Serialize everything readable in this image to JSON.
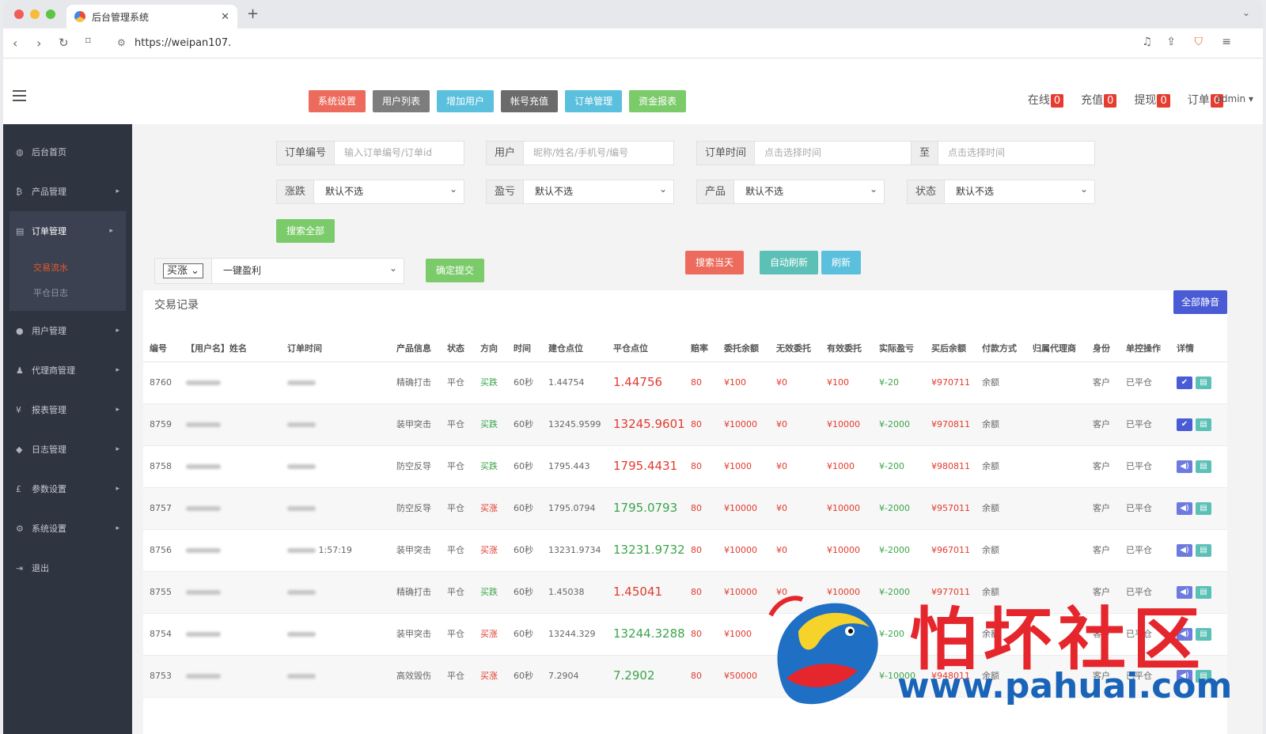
{
  "browser": {
    "tab_title": "后台管理系统",
    "url": "https://weipan107."
  },
  "header": {
    "buttons": [
      {
        "label": "系统设置",
        "color": "#ec6b5d"
      },
      {
        "label": "用户列表",
        "color": "#7d7d7d"
      },
      {
        "label": "增加用户",
        "color": "#5bc0de"
      },
      {
        "label": "帐号充值",
        "color": "#6b6b6b"
      },
      {
        "label": "订单管理",
        "color": "#5bc0de"
      },
      {
        "label": "资金报表",
        "color": "#7ccb6b"
      }
    ],
    "stats": [
      {
        "label": "在线",
        "count": "0"
      },
      {
        "label": "充值",
        "count": "0"
      },
      {
        "label": "提现",
        "count": "0"
      },
      {
        "label": "订单",
        "count": "0"
      }
    ],
    "user": "admin"
  },
  "sidebar": {
    "items": [
      {
        "label": "后台首页",
        "icon": "dashboard-icon"
      },
      {
        "label": "产品管理",
        "icon": "bitcoin-icon"
      },
      {
        "label": "订单管理",
        "icon": "order-icon"
      },
      {
        "label": "用户管理",
        "icon": "user-icon"
      },
      {
        "label": "代理商管理",
        "icon": "agent-icon"
      },
      {
        "label": "报表管理",
        "icon": "yen-icon"
      },
      {
        "label": "日志管理",
        "icon": "tag-icon"
      },
      {
        "label": "参数设置",
        "icon": "pound-icon"
      },
      {
        "label": "系统设置",
        "icon": "gears-icon"
      },
      {
        "label": "退出",
        "icon": "logout-icon"
      }
    ],
    "sub_items": [
      "交易流水",
      "平仓日志"
    ]
  },
  "filters": {
    "order_no_label": "订单编号",
    "order_no_placeholder": "输入订单编号/订单id",
    "user_label": "用户",
    "user_placeholder": "昵称/姓名/手机号/编号",
    "time_label": "订单时间",
    "time_start_placeholder": "点击选择时间",
    "to_label": "至",
    "time_end_placeholder": "点击选择时间",
    "rise_label": "涨跌",
    "rise_value": "默认不选",
    "pl_label": "盈亏",
    "pl_value": "默认不选",
    "product_label": "产品",
    "product_value": "默认不选",
    "status_label": "状态",
    "status_value": "默认不选",
    "search_all": "搜索全部"
  },
  "actions": {
    "direction_value": "买涨",
    "mode_value": "一键盈利",
    "confirm": "确定提交",
    "search_today": "搜索当天",
    "auto_refresh": "自动刷新",
    "refresh": "刷新"
  },
  "records": {
    "title": "交易记录",
    "mute_all": "全部静音",
    "columns": [
      "编号",
      "【用户名】姓名",
      "订单时间",
      "产品信息",
      "状态",
      "方向",
      "时间",
      "建仓点位",
      "平仓点位",
      "赔率",
      "委托余额",
      "无效委托",
      "有效委托",
      "实际盈亏",
      "买后余额",
      "付款方式",
      "归属代理商",
      "身份",
      "单控操作",
      "详情"
    ],
    "rows": [
      {
        "id": "8760",
        "time_text": "",
        "product": "精确打击",
        "status": "平仓",
        "dir": "买跌",
        "dir_color": "red",
        "dur": "60秒",
        "open": "1.44754",
        "close": "1.44756",
        "close_color": "red",
        "odds": "80",
        "entrust": "¥100",
        "invalid": "¥0",
        "valid": "¥100",
        "pl": "¥-20",
        "balance": "¥970711",
        "pay": "余额",
        "role": "客户",
        "ctrl": "已平仓",
        "icon": "check"
      },
      {
        "id": "8759",
        "time_text": "",
        "product": "装甲突击",
        "status": "平仓",
        "dir": "买跌",
        "dir_color": "red",
        "dur": "60秒",
        "open": "13245.9599",
        "close": "13245.9601",
        "close_color": "red",
        "odds": "80",
        "entrust": "¥10000",
        "invalid": "¥0",
        "valid": "¥10000",
        "pl": "¥-2000",
        "balance": "¥970811",
        "pay": "余额",
        "role": "客户",
        "ctrl": "已平仓",
        "icon": "check"
      },
      {
        "id": "8758",
        "time_text": "",
        "product": "防空反导",
        "status": "平仓",
        "dir": "买跌",
        "dir_color": "red",
        "dur": "60秒",
        "open": "1795.443",
        "close": "1795.4431",
        "close_color": "red",
        "odds": "80",
        "entrust": "¥1000",
        "invalid": "¥0",
        "valid": "¥1000",
        "pl": "¥-200",
        "balance": "¥980811",
        "pay": "余额",
        "role": "客户",
        "ctrl": "已平仓",
        "icon": "sound"
      },
      {
        "id": "8757",
        "time_text": "",
        "product": "防空反导",
        "status": "平仓",
        "dir": "买涨",
        "dir_color": "red",
        "dur": "60秒",
        "open": "1795.0794",
        "close": "1795.0793",
        "close_color": "green",
        "odds": "80",
        "entrust": "¥10000",
        "invalid": "¥0",
        "valid": "¥10000",
        "pl": "¥-2000",
        "balance": "¥957011",
        "pay": "余额",
        "role": "客户",
        "ctrl": "已平仓",
        "icon": "sound"
      },
      {
        "id": "8756",
        "time_text": "1:57:19",
        "product": "装甲突击",
        "status": "平仓",
        "dir": "买涨",
        "dir_color": "red",
        "dur": "60秒",
        "open": "13231.9734",
        "close": "13231.9732",
        "close_color": "green",
        "odds": "80",
        "entrust": "¥10000",
        "invalid": "¥0",
        "valid": "¥10000",
        "pl": "¥-2000",
        "balance": "¥967011",
        "pay": "余额",
        "role": "客户",
        "ctrl": "已平仓",
        "icon": "sound"
      },
      {
        "id": "8755",
        "time_text": "",
        "product": "精确打击",
        "status": "平仓",
        "dir": "买跌",
        "dir_color": "red",
        "dur": "60秒",
        "open": "1.45038",
        "close": "1.45041",
        "close_color": "red",
        "odds": "80",
        "entrust": "¥10000",
        "invalid": "¥0",
        "valid": "¥10000",
        "pl": "¥-2000",
        "balance": "¥977011",
        "pay": "余额",
        "role": "客户",
        "ctrl": "已平仓",
        "icon": "sound"
      },
      {
        "id": "8754",
        "time_text": "",
        "product": "装甲突击",
        "status": "平仓",
        "dir": "买涨",
        "dir_color": "red",
        "dur": "60秒",
        "open": "13244.329",
        "close": "13244.3288",
        "close_color": "green",
        "odds": "80",
        "entrust": "¥1000",
        "invalid": "",
        "valid": "¥1000",
        "pl": "¥-200",
        "balance": "",
        "pay": "余额",
        "role": "客户",
        "ctrl": "已平仓",
        "icon": "sound"
      },
      {
        "id": "8753",
        "time_text": "",
        "product": "高效毁伤",
        "status": "平仓",
        "dir": "买涨",
        "dir_color": "red",
        "dur": "60秒",
        "open": "7.2904",
        "close": "7.2902",
        "close_color": "green",
        "odds": "80",
        "entrust": "¥50000",
        "invalid": "",
        "valid": "",
        "pl": "¥-10000",
        "balance": "¥948011",
        "pay": "余额",
        "role": "客户",
        "ctrl": "已平仓",
        "icon": "sound"
      }
    ]
  },
  "watermark": {
    "text": "怕坏社区",
    "url": "www.pahuai.com"
  }
}
